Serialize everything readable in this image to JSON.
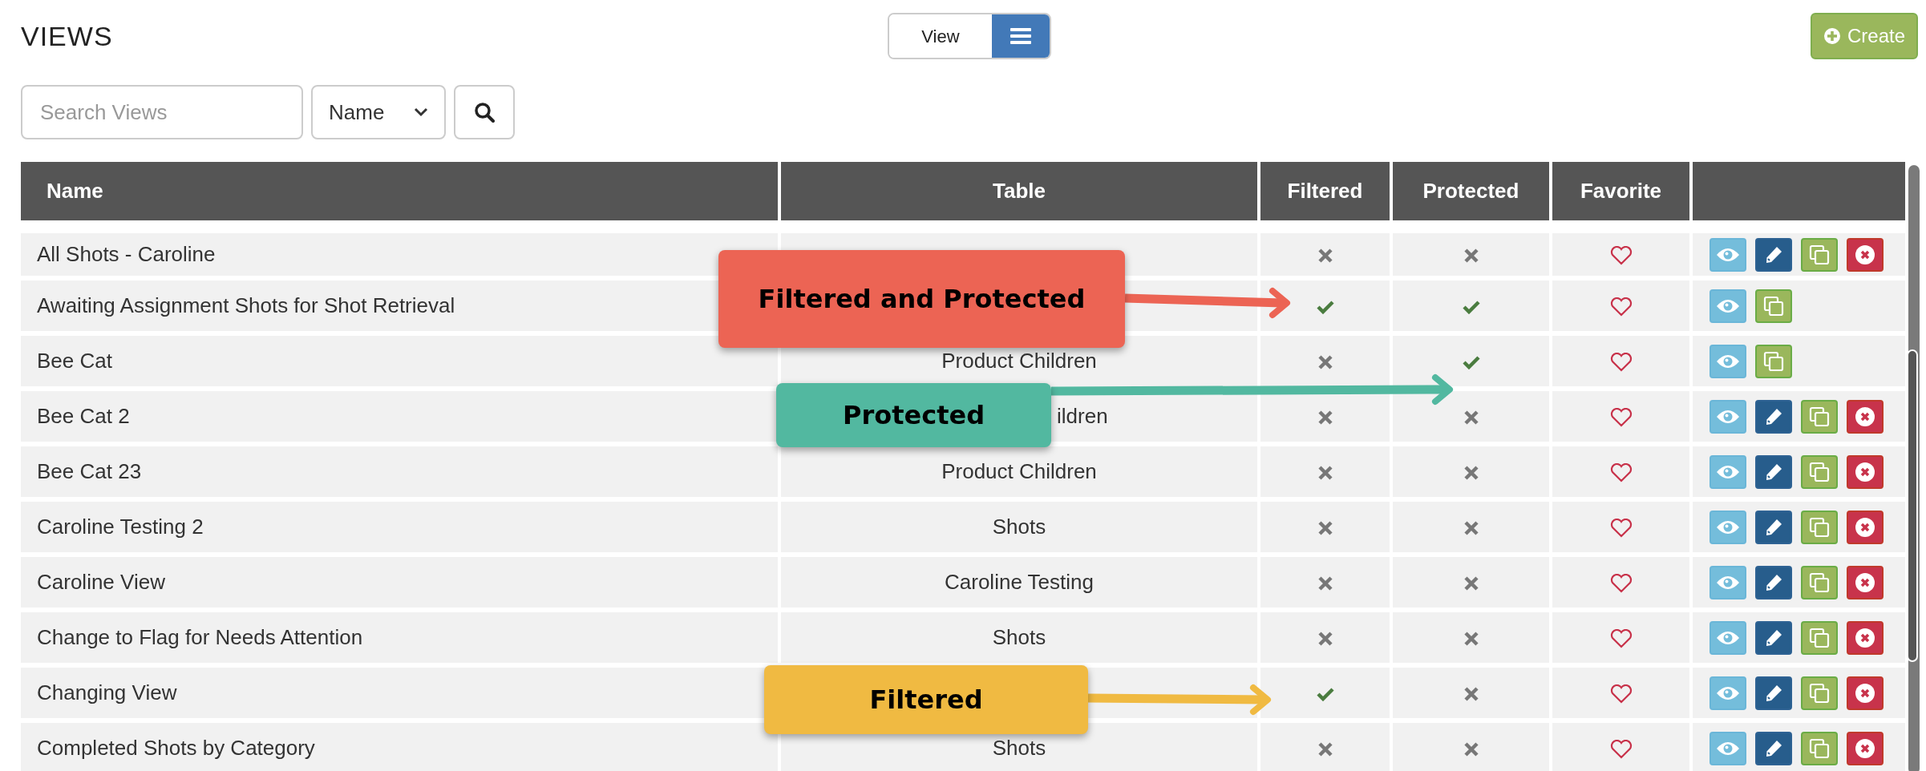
{
  "title": "VIEWS",
  "view_toggle": [
    {
      "kind": "label",
      "label": "View",
      "selected": false
    },
    {
      "kind": "list",
      "selected": true
    }
  ],
  "create_button": {
    "label": "Create"
  },
  "search": {
    "placeholder": "Search Views"
  },
  "sort_select": {
    "value": "Name"
  },
  "table": {
    "columns": [
      "Name",
      "Table",
      "Filtered",
      "Protected",
      "Favorite"
    ],
    "rows": [
      {
        "name": "All Shots - Caroline",
        "filtered": false,
        "protected": false,
        "favorite": false,
        "actions": [
          {
            "kind": "view"
          },
          {
            "kind": "edit"
          },
          {
            "kind": "copy"
          },
          {
            "kind": "delete"
          }
        ]
      },
      {
        "name": "Awaiting Assignment Shots for Shot Retrieval",
        "filtered": true,
        "protected": true,
        "favorite": false,
        "actions": [
          {
            "kind": "view"
          },
          {
            "kind": "copy"
          }
        ]
      },
      {
        "name": "Bee Cat",
        "table": "Product Children",
        "filtered": false,
        "protected": true,
        "favorite": false,
        "actions": [
          {
            "kind": "view"
          },
          {
            "kind": "copy"
          }
        ]
      },
      {
        "name": "Bee Cat 2",
        "table": "ildren",
        "table_partly_covered": true,
        "filtered": false,
        "protected": false,
        "favorite": false,
        "actions": [
          {
            "kind": "view"
          },
          {
            "kind": "edit"
          },
          {
            "kind": "copy"
          },
          {
            "kind": "delete"
          }
        ]
      },
      {
        "name": "Bee Cat 23",
        "table": "Product Children",
        "filtered": false,
        "protected": false,
        "favorite": false,
        "actions": [
          {
            "kind": "view"
          },
          {
            "kind": "edit"
          },
          {
            "kind": "copy"
          },
          {
            "kind": "delete"
          }
        ]
      },
      {
        "name": "Caroline Testing 2",
        "table": "Shots",
        "filtered": false,
        "protected": false,
        "favorite": false,
        "actions": [
          {
            "kind": "view"
          },
          {
            "kind": "edit"
          },
          {
            "kind": "copy"
          },
          {
            "kind": "delete"
          }
        ]
      },
      {
        "name": "Caroline View",
        "table": "Caroline Testing",
        "filtered": false,
        "protected": false,
        "favorite": false,
        "actions": [
          {
            "kind": "view"
          },
          {
            "kind": "edit"
          },
          {
            "kind": "copy"
          },
          {
            "kind": "delete"
          }
        ]
      },
      {
        "name": "Change to Flag for Needs Attention",
        "table": "Shots",
        "filtered": false,
        "protected": false,
        "favorite": false,
        "actions": [
          {
            "kind": "view"
          },
          {
            "kind": "edit"
          },
          {
            "kind": "copy"
          },
          {
            "kind": "delete"
          }
        ]
      },
      {
        "name": "Changing View",
        "filtered": true,
        "protected": false,
        "favorite": false,
        "actions": [
          {
            "kind": "view"
          },
          {
            "kind": "edit"
          },
          {
            "kind": "copy"
          },
          {
            "kind": "delete"
          }
        ]
      },
      {
        "name": "Completed Shots by Category",
        "table": "Shots",
        "filtered": false,
        "protected": false,
        "favorite": false,
        "actions": [
          {
            "kind": "view"
          },
          {
            "kind": "edit"
          },
          {
            "kind": "copy"
          },
          {
            "kind": "delete"
          }
        ]
      }
    ]
  },
  "callouts": [
    {
      "label": "Filtered and Protected",
      "color": "#ec6454"
    },
    {
      "label": "Protected",
      "color": "#52b8a0"
    },
    {
      "label": "Filtered",
      "color": "#f0ba42"
    }
  ]
}
